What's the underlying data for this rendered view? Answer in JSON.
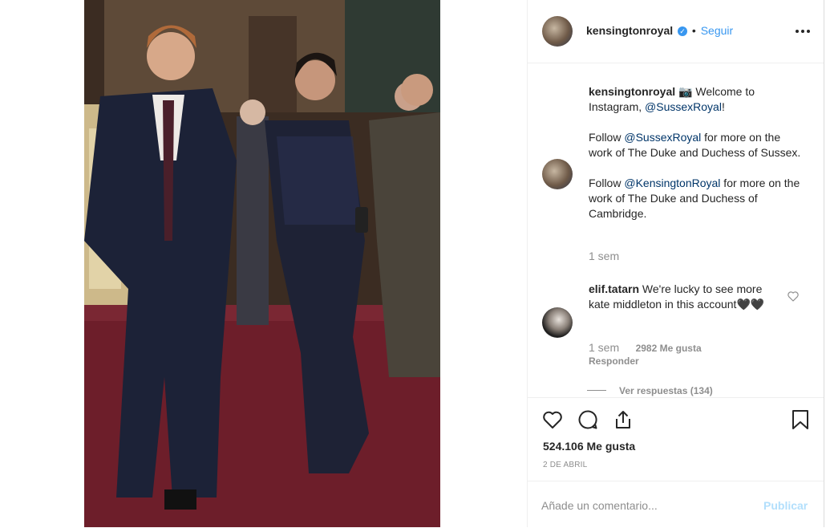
{
  "post": {
    "username": "kensingtonroyal",
    "follow_separator": "•",
    "follow_label": "Seguir",
    "more_options_icon": "ellipsis-icon"
  },
  "caption": {
    "username": "kensingtonroyal",
    "line1_emoji": "📷",
    "line1_text": " Welcome to Instagram, ",
    "line1_mention": "@SussexRoyal",
    "line1_end": "!",
    "para2_prefix": "Follow ",
    "para2_mention": "@SussexRoyal",
    "para2_suffix": " for more on the work of The Duke and Duchess of Sussex.",
    "para3_prefix": "Follow ",
    "para3_mention": "@KensingtonRoyal",
    "para3_suffix": " for more on the work of The Duke and Duchess of Cambridge.",
    "time": "1 sem"
  },
  "comment": {
    "username": "elif.tatarn",
    "text": " We're lucky to see more kate middleton in this account🖤🖤",
    "time": "1 sem",
    "likes": "2982 Me gusta",
    "reply": "Responder",
    "view_replies": "Ver respuestas (134)"
  },
  "stats": {
    "likes": "524.106 Me gusta",
    "date": "2 DE ABRIL"
  },
  "add_comment": {
    "placeholder": "Añade un comentario...",
    "publish": "Publicar"
  },
  "colors": {
    "link_blue": "#003569",
    "follow_blue": "#3897f0",
    "publish_disabled": "#b2dffc"
  }
}
